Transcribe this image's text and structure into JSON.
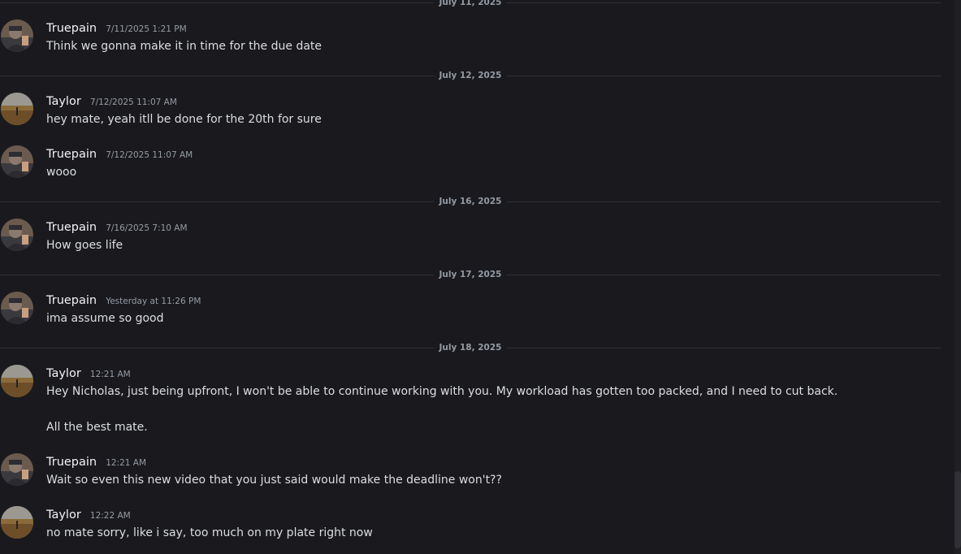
{
  "date_dividers": [
    "July 11, 2025",
    "July 12, 2025",
    "July 16, 2025",
    "July 17, 2025",
    "July 18, 2025"
  ],
  "messages": [
    {
      "author": "Truepain",
      "time": "7/11/2025 1:21 PM",
      "text": "Think we gonna make it in time for the due date"
    },
    {
      "author": "Taylor",
      "time": "7/12/2025 11:07 AM",
      "text": "hey mate, yeah itll be done for the 20th for sure"
    },
    {
      "author": "Truepain",
      "time": "7/12/2025 11:07 AM",
      "text": "wooo"
    },
    {
      "author": "Truepain",
      "time": "7/16/2025 7:10 AM",
      "text": "How goes life"
    },
    {
      "author": "Truepain",
      "time": "Yesterday at 11:26 PM",
      "text": "ima assume so good"
    },
    {
      "author": "Taylor",
      "time": "12:21 AM",
      "text": "Hey Nicholas, just being upfront, I won't be able to continue working with you. My workload has gotten too packed, and I need to cut back.",
      "text2": "All the best mate."
    },
    {
      "author": "Truepain",
      "time": "12:21 AM",
      "text": "Wait so even this new video that you just said would make the deadline won't??"
    },
    {
      "author": "Taylor",
      "time": "12:22 AM",
      "text": "no mate sorry, like i say, too much on my plate right now"
    }
  ]
}
